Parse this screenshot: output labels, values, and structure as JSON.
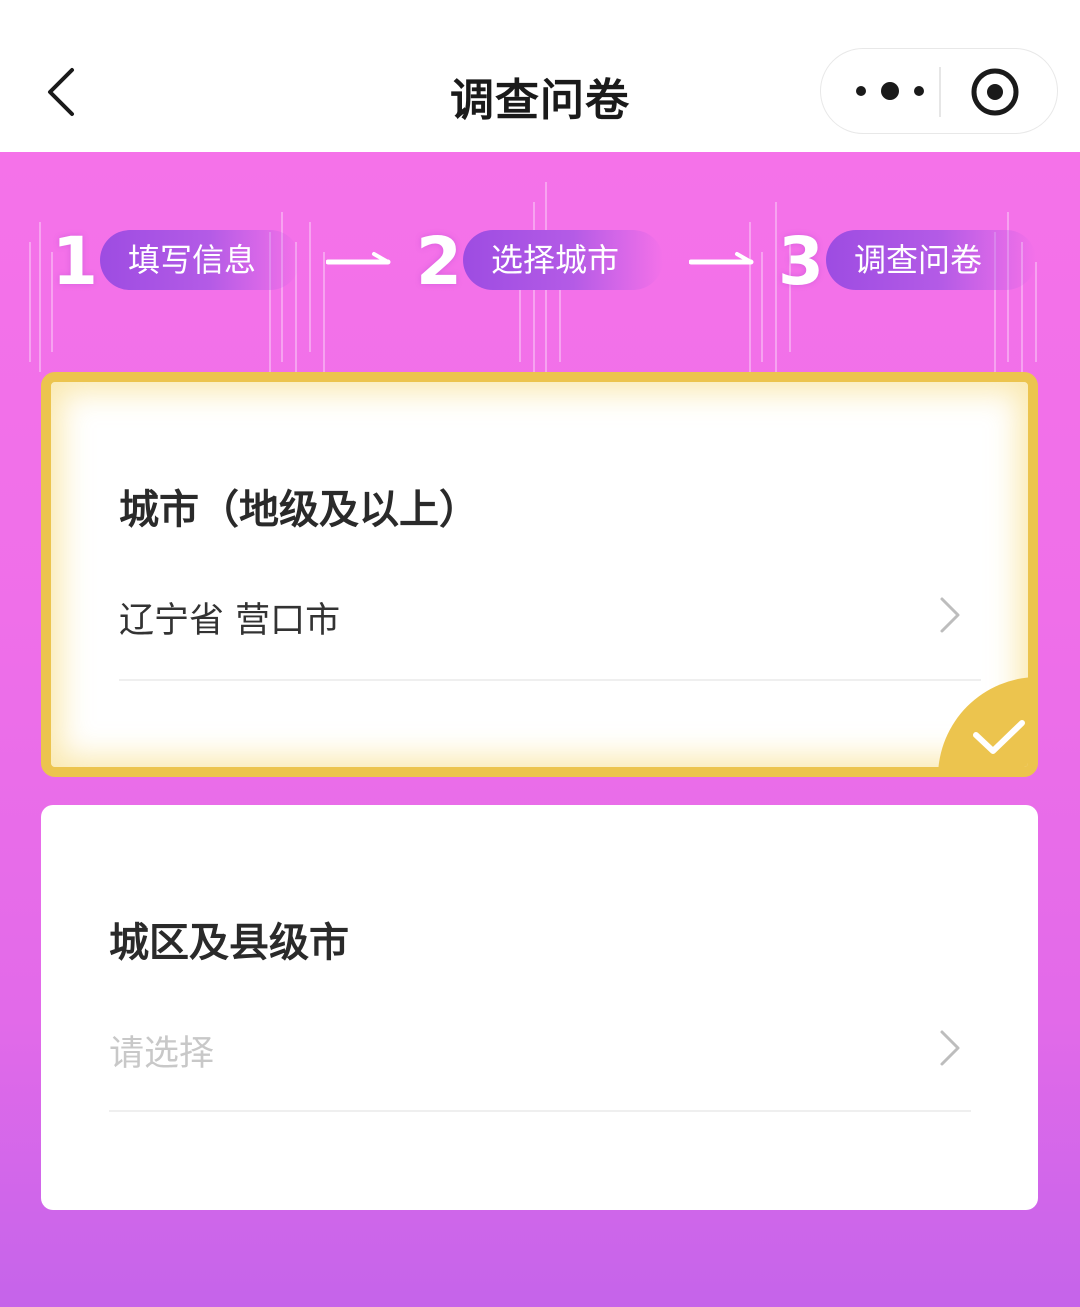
{
  "nav": {
    "title": "调查问卷",
    "back_icon": "chevron-left-icon",
    "more_icon": "more-dots-icon",
    "close_icon": "target-circle-icon"
  },
  "steps": [
    {
      "number": "1",
      "label": "填写信息"
    },
    {
      "number": "2",
      "label": "选择城市"
    },
    {
      "number": "3",
      "label": "调查问卷"
    }
  ],
  "city_card": {
    "title": "城市（地级及以上）",
    "value": "辽宁省 营口市",
    "selected": true
  },
  "district_card": {
    "title": "城区及县级市",
    "placeholder": "请选择"
  },
  "colors": {
    "background_top": "#f572e9",
    "background_bottom": "#c564ea",
    "step_pill": "#9d4ce2",
    "selected_border": "#ecc44e"
  }
}
